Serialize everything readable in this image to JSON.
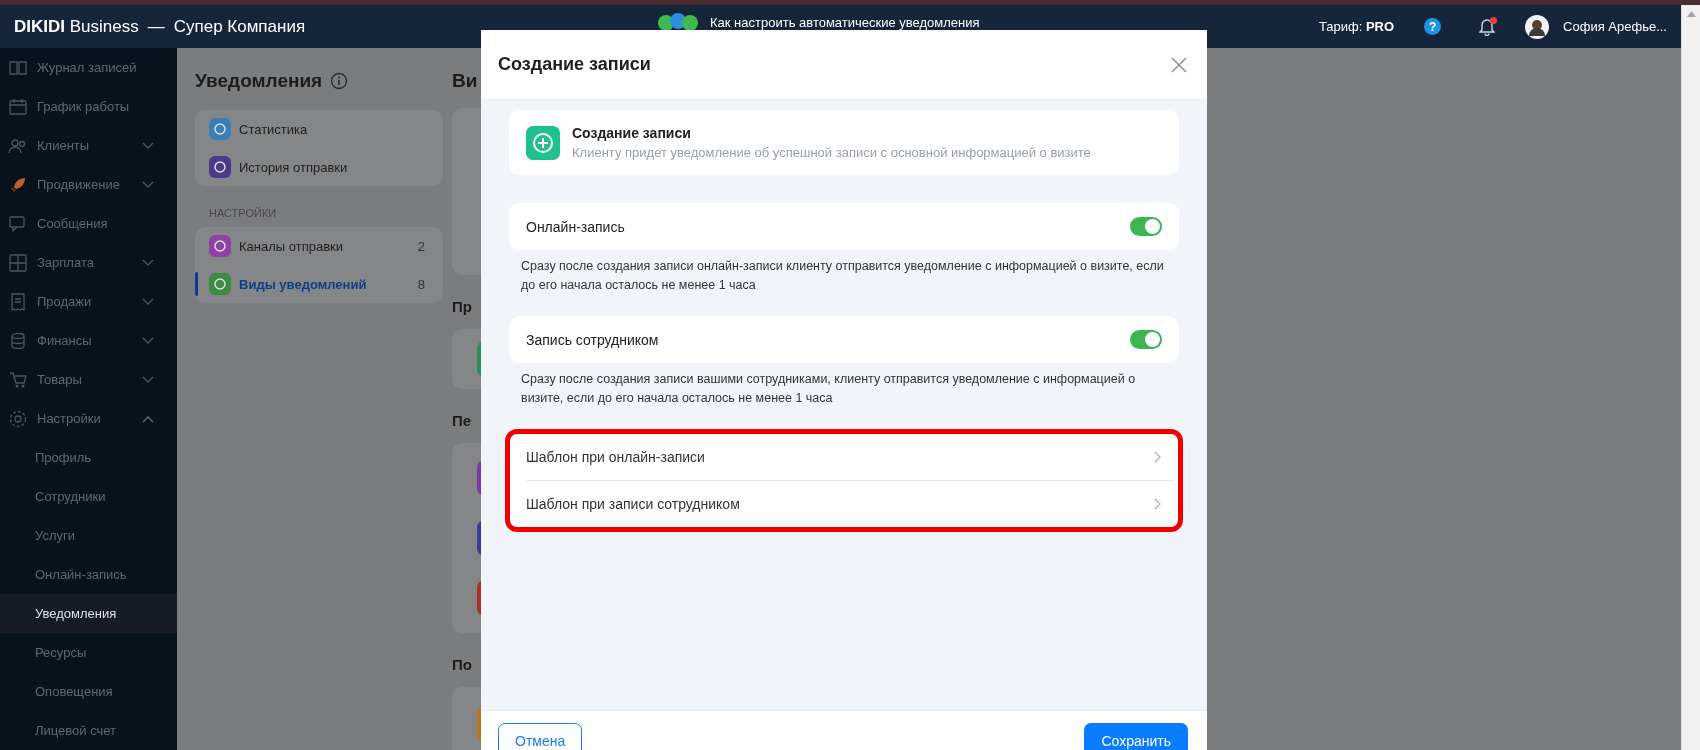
{
  "top_bar": {
    "brand": "**DIKIDI** Business",
    "separator": "—",
    "company": "Супер Компания",
    "help_link": "Как настроить автоматические уведомления",
    "plan": "Тариф: **PRO**",
    "help_icon": "?",
    "has_unread": true,
    "user_name": "София Арефье..."
  },
  "sidebar": {
    "items": [
      {
        "label": "Журнал записей",
        "selected": false
      },
      {
        "label": "График работы",
        "selected": false
      },
      {
        "label": "Клиенты",
        "selected": false,
        "expanded": false
      },
      {
        "label": "Продвижение",
        "selected": false,
        "expanded": false
      },
      {
        "label": "Сообщения",
        "selected": false
      },
      {
        "label": "Зарплата",
        "selected": false,
        "expanded": false
      },
      {
        "label": "Продажи",
        "selected": false,
        "expanded": false
      },
      {
        "label": "Финансы",
        "selected": false,
        "expanded": false
      },
      {
        "label": "Товары",
        "selected": false,
        "expanded": false
      },
      {
        "label": "Настройки",
        "selected": false,
        "expanded": true,
        "children": [
          {
            "label": "Профиль",
            "selected": false
          },
          {
            "label": "Сотрудники",
            "selected": false
          },
          {
            "label": "Услуги",
            "selected": false
          },
          {
            "label": "Онлайн-запись",
            "selected": false
          },
          {
            "label": "Уведомления",
            "selected": true
          },
          {
            "label": "Ресурсы",
            "selected": false
          },
          {
            "label": "Оповещения",
            "selected": false
          },
          {
            "label": "Лицевой счет",
            "selected": false
          }
        ]
      }
    ]
  },
  "notifications_panel": {
    "title": "Уведомления",
    "groups": [
      {
        "items": [
          {
            "label": "Статистика",
            "selected": false
          },
          {
            "label": "История отправки",
            "selected": false
          }
        ]
      },
      {
        "heading": "НАСТРОЙКИ",
        "items": [
          {
            "label": "Каналы отправки",
            "count": "2",
            "selected": false
          },
          {
            "label": "Виды уведомлений",
            "count": "8",
            "selected": true
          }
        ]
      }
    ]
  },
  "column_2": {
    "headings": [
      "Ви",
      "Пр",
      "Пе",
      "По"
    ]
  },
  "modal": {
    "title": "Создание записи",
    "card": {
      "title": "Создание записи",
      "description": "Клиенту придет уведомление об успешной записи с основной информацией о визите"
    },
    "toggles": [
      {
        "label": "Онлайн-запись",
        "on": true,
        "description": "Сразу после создания записи онлайн-записи клиенту отправится уведомление с информацией о визите, если до его начала осталось не менее 1 часа"
      },
      {
        "label": "Запись сотрудником",
        "on": true,
        "description": "Сразу после создания записи вашими сотрудниками, клиенту отправится уведомление с информацией о визите, если до его начала осталось не менее 1 часа"
      }
    ],
    "templates": {
      "highlighted": true,
      "items": [
        {
          "label": "Шаблон при онлайн-записи"
        },
        {
          "label": "Шаблон при записи сотрудником"
        }
      ]
    },
    "buttons": [
      {
        "label": "Отмена",
        "kind": "secondary"
      },
      {
        "label": "Сохранить",
        "kind": "primary"
      }
    ]
  }
}
